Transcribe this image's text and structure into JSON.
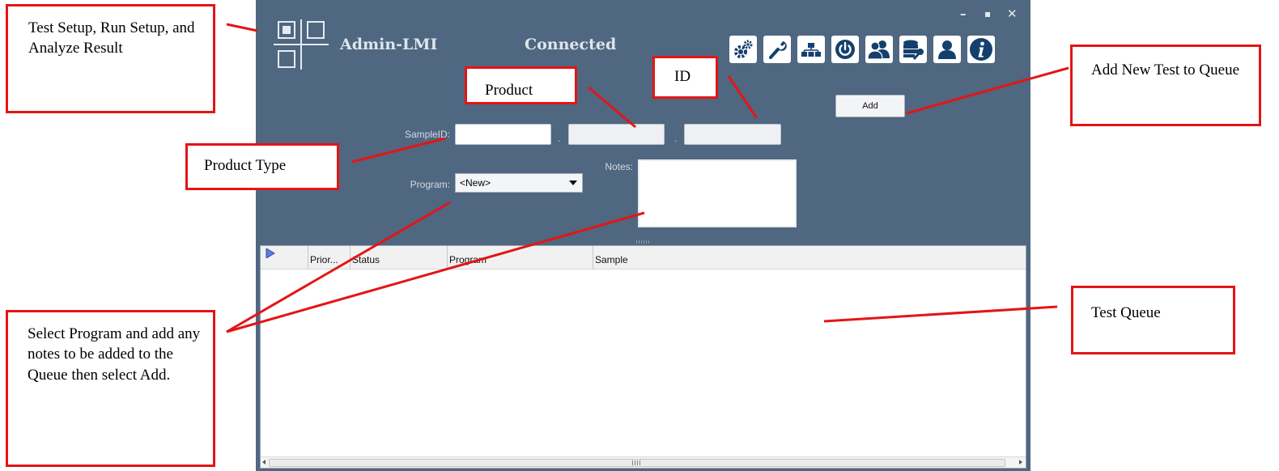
{
  "window": {
    "title": "Admin-LMI",
    "connection_status": "Connected",
    "controls": {
      "minimize": "–",
      "maximize": "▪",
      "close": "✕"
    }
  },
  "toolbar": {
    "buttons": [
      {
        "icon": "gears-icon"
      },
      {
        "icon": "wrench-icon"
      },
      {
        "icon": "network-icon"
      },
      {
        "icon": "power-icon"
      },
      {
        "icon": "users-icon"
      },
      {
        "icon": "database-settings-icon"
      },
      {
        "icon": "user-icon"
      },
      {
        "icon": "info-icon"
      }
    ],
    "icon_color": "#14406e"
  },
  "form": {
    "sample_id_label": "SampleID:",
    "separator": ".",
    "product_type_value": "",
    "product_value": "",
    "id_value": "",
    "program_label": "Program:",
    "program_selected": "<New>",
    "notes_label": "Notes:",
    "notes_value": "",
    "add_label": "Add"
  },
  "queue": {
    "columns": [
      "",
      "Prior...",
      "Status",
      "Program",
      "Sample"
    ],
    "rows": []
  },
  "annotations": {
    "test_setup": "Test Setup, Run Setup, and Analyze Result",
    "product": "Product",
    "id": "ID",
    "add_new": "Add New Test to Queue",
    "product_type": "Product Type",
    "select_program": "Select Program and add any notes to be added to the Queue then select Add.",
    "test_queue": "Test Queue"
  },
  "colors": {
    "window_bg": "#4f6780",
    "annotation_red": "#e41515"
  }
}
